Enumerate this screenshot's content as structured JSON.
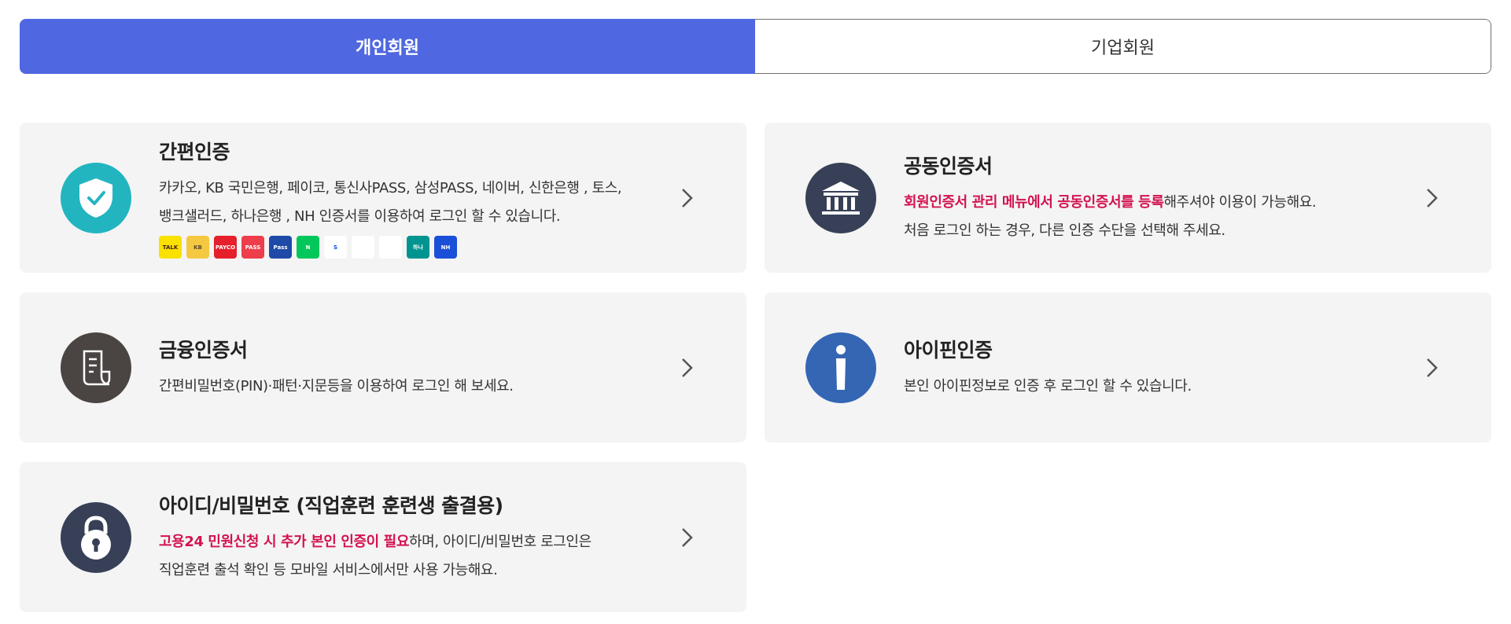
{
  "tabs": [
    {
      "label": "개인회원",
      "active": true
    },
    {
      "label": "기업회원",
      "active": false
    }
  ],
  "cards": {
    "simple": {
      "title": "간편인증",
      "desc_line1": "카카오, KB 국민은행, 페이코, 통신사PASS, 삼성PASS, 네이버, 신한은행 , 토스,",
      "desc_line2": "뱅크샐러드, 하나은행 , NH 인증서를 이용하여 로그인 할 수 있습니다.",
      "icon": "shield-check-icon",
      "icon_color": "#22b5c0",
      "logos": [
        {
          "name": "kakao-logo",
          "text": "TALK",
          "bg": "#fae100",
          "fg": "#3c1e1e"
        },
        {
          "name": "kb-logo",
          "text": "KB",
          "bg": "#f5c842",
          "fg": "#5a4a2a"
        },
        {
          "name": "payco-logo",
          "text": "PAYCO",
          "bg": "#e6202a",
          "fg": "#ffffff"
        },
        {
          "name": "pass-logo",
          "text": "PASS",
          "bg": "#ee3d4b",
          "fg": "#ffffff"
        },
        {
          "name": "samsung-pass-logo",
          "text": "Pass",
          "bg": "#1f4aa8",
          "fg": "#ffffff"
        },
        {
          "name": "naver-logo",
          "text": "N",
          "bg": "#03c75a",
          "fg": "#ffffff"
        },
        {
          "name": "shinhan-logo",
          "text": "S",
          "bg": "#ffffff",
          "fg": "#0046ff"
        },
        {
          "name": "toss-logo",
          "text": "",
          "bg": "#ffffff",
          "fg": "#1b64da"
        },
        {
          "name": "banksalad-logo",
          "text": "",
          "bg": "#ffffff",
          "fg": "#16b46a"
        },
        {
          "name": "hana-logo",
          "text": "하나",
          "bg": "#009490",
          "fg": "#ffffff"
        },
        {
          "name": "nh-logo",
          "text": "NH",
          "bg": "#1a4fd8",
          "fg": "#ffffff"
        }
      ]
    },
    "joint": {
      "title": "공동인증서",
      "desc_hl": "회원인증서 관리 메뉴에서 공동인증서를 등록",
      "desc_rest": "해주셔야 이용이 가능해요.",
      "desc_line2": "처음 로그인 하는 경우, 다른 인증 수단을 선택해 주세요.",
      "icon": "bank-icon",
      "icon_color": "#374057"
    },
    "financial": {
      "title": "금융인증서",
      "desc_line1": "간편비밀번호(PIN)·패턴·지문등을 이용하여 로그인 해 보세요.",
      "icon": "document-icon",
      "icon_color": "#4a4543"
    },
    "ipin": {
      "title": "아이핀인증",
      "desc_line1": "본인 아이핀정보로 인증 후 로그인 할 수 있습니다.",
      "icon": "info-icon",
      "icon_color": "#3466b4"
    },
    "idpw": {
      "title": "아이디/비밀번호 (직업훈련 훈련생 출결용)",
      "desc_hl": "고용24 민원신청 시 추가 본인 인증이 필요",
      "desc_rest": "하며, 아이디/비밀번호 로그인은",
      "desc_line2": "직업훈련 출석 확인 등 모바일 서비스에서만 사용 가능해요.",
      "icon": "lock-icon",
      "icon_color": "#374057"
    }
  }
}
